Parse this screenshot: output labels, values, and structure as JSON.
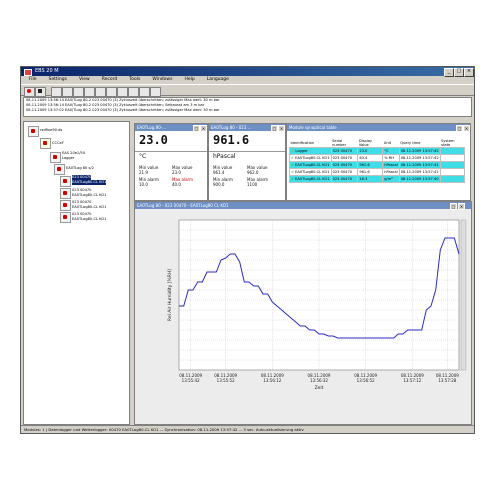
{
  "window": {
    "title": "EBS 20 M"
  },
  "menu": [
    "File",
    "Settings",
    "View",
    "Record",
    "Tools",
    "Windows",
    "Help",
    "Language"
  ],
  "log": [
    "08.11.2009 13:56:14  EA0/TLog 80-2 023 00470 (3) Zykluszeit überschritten; zulässiger Max wert: 30 m bar",
    "08.11.2009 13:56:14  EA0/TLog 80-2 023 00470 (3) Zykluszeit überschritten; Seikausst am 3 m bar",
    "08.11.2009 13:57:02  EA0/TLog 80-2 023 00470 (3) Zykluszeit überschritten; zulässiger Max wert: 30 m bar"
  ],
  "tree": {
    "root": "rsdfine90.ds",
    "group": "CCCeF",
    "devices": [
      {
        "label": "EAS 20e1/50",
        "sub": "Logger"
      },
      {
        "label": "EA0TLog 80 s/2"
      },
      {
        "label": "023 00470",
        "sub": "EA0TLog80-CL KO1",
        "selected": true
      },
      {
        "label": "023 00470",
        "sub": "EA0TLog80-CL KO1"
      },
      {
        "label": "023 00470",
        "sub": "EA0TLog80-CL KO1"
      },
      {
        "label": "023 00470",
        "sub": "EA0TLog80-CL KO1"
      }
    ]
  },
  "panel1": {
    "title": "EA0TLog 80-...",
    "value": "23.0",
    "unit": "°C",
    "min_value_label": "Min value",
    "min_value": "21.9",
    "max_value_label": "Max value",
    "max_value": "23.0",
    "min_alarm_label": "Min alarm",
    "min_alarm": "10.0",
    "max_alarm_label": "Max alarm",
    "max_alarm": "40.0"
  },
  "panel2": {
    "title": "EA0TLog 80 - 023 ...",
    "value": "961.6",
    "unit": "hPascal",
    "min_value_label": "Min value",
    "min_value": "961.4",
    "max_value_label": "Max value",
    "max_value": "962.0",
    "min_alarm_label": "Min alarm",
    "min_alarm": "900.0",
    "max_alarm_label": "Max alarm",
    "max_alarm": "1100"
  },
  "table": {
    "title": "Module synoptical table",
    "headers": [
      "Identification",
      "Serial number",
      "Display Value",
      "Unit",
      "Query time",
      "System state"
    ],
    "rows": [
      {
        "id": "Logger",
        "serial": "023 00470",
        "value": "23.0",
        "unit": "°C",
        "time": "08.11.2009 13:57:42",
        "state": "",
        "cyan": true,
        "warn": true
      },
      {
        "id": "EA0TLog80-CL KO1",
        "serial": "023 00470",
        "value": "63.4",
        "unit": "% RH",
        "time": "08.11.2009 13:57:42",
        "state": "",
        "cyan": false,
        "warn": false
      },
      {
        "id": "EA0TLog80-CL KO1",
        "serial": "023 00470",
        "value": "961.6",
        "unit": "hPascal",
        "time": "08.11.2009 13:57:41",
        "state": "",
        "cyan": true,
        "warn": false
      },
      {
        "id": "EA0TLog80-CL KO1",
        "serial": "023 00470",
        "value": "961.6",
        "unit": "hPascal",
        "time": "08.11.2009 13:57:41",
        "state": "",
        "cyan": false,
        "warn": false
      },
      {
        "id": "EA0TLog80-CL KO1",
        "serial": "023 00470",
        "value": "16.3",
        "unit": "g/m³",
        "time": "08.11.2009 13:57:40",
        "state": "",
        "cyan": true,
        "warn": false
      }
    ]
  },
  "chartwin": {
    "title": "EA0TLog 80 - 023 00470 - EA0TLog80 CL KO1"
  },
  "chart_data": {
    "type": "line",
    "title": "",
    "xlabel": "Zeit",
    "ylabel": "Rel Air Humidity [%RH]",
    "ylim": [
      20,
      95
    ],
    "xlim": [
      0,
      120
    ],
    "x_tick_labels": [
      {
        "x": 5,
        "date": "08.11.2009",
        "time": "13:55:42"
      },
      {
        "x": 20,
        "date": "08.11.2009",
        "time": "13:55:52"
      },
      {
        "x": 40,
        "date": "08.11.2009",
        "time": "13:56:12"
      },
      {
        "x": 60,
        "date": "08.11.2009",
        "time": "13:56:32"
      },
      {
        "x": 80,
        "date": "08.11.2009",
        "time": "13:56:52"
      },
      {
        "x": 100,
        "date": "08.11.2009",
        "time": "13:57:12"
      },
      {
        "x": 115,
        "date": "08.11.2009",
        "time": "13:57:28"
      }
    ],
    "series": [
      {
        "color": "#2b2bbf",
        "x": [
          0,
          2,
          4,
          6,
          8,
          10,
          12,
          14,
          16,
          18,
          20,
          22,
          24,
          26,
          28,
          30,
          32,
          34,
          36,
          38,
          40,
          42,
          44,
          46,
          48,
          50,
          52,
          54,
          56,
          58,
          60,
          62,
          64,
          66,
          68,
          70,
          72,
          74,
          76,
          78,
          80,
          82,
          84,
          86,
          88,
          90,
          92,
          94,
          96,
          98,
          100,
          102,
          104,
          106,
          108,
          110,
          112,
          114,
          116,
          118,
          120
        ],
        "y": [
          52,
          52,
          60,
          60,
          64,
          64,
          69,
          69,
          69,
          75,
          76,
          78,
          78,
          74,
          64,
          64,
          62,
          62,
          58,
          58,
          54,
          52,
          50,
          48,
          46,
          44,
          42,
          42,
          40,
          40,
          38,
          38,
          37,
          37,
          36,
          36,
          36,
          36,
          36,
          36,
          36,
          36,
          36,
          36,
          36,
          36,
          36,
          38,
          38,
          40,
          40,
          40,
          40,
          50,
          52,
          60,
          80,
          86,
          86,
          86,
          78
        ]
      }
    ]
  },
  "statusbar": "Modules: 1  | Datenlogger und Wetterlogger: 00470 EA0TLog80-CL KO1 ... Synchronisation: 08.11.2009 13:57:42 ... 5 sec. Auto-aktualisierung aktiv"
}
